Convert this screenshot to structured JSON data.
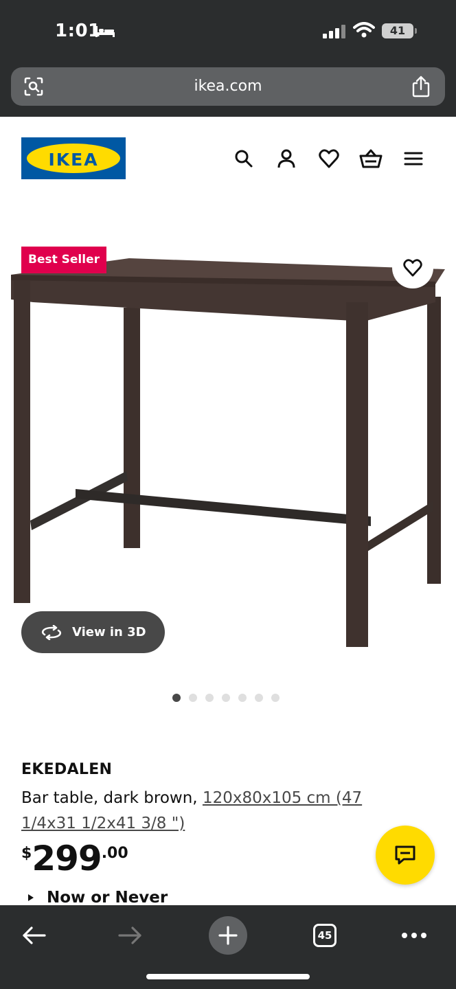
{
  "status": {
    "time": "1:01",
    "battery": "41",
    "icons": [
      "bed-icon",
      "signal-icon",
      "wifi-icon",
      "battery-icon"
    ]
  },
  "browser": {
    "url": "ikea.com",
    "left_icon": "lens-icon",
    "right_icon": "share-icon"
  },
  "header": {
    "logo_text": "IKEA",
    "icons": [
      "search-icon",
      "account-icon",
      "heart-icon",
      "cart-icon",
      "menu-icon"
    ]
  },
  "product": {
    "badge": "Best Seller",
    "view3d_label": "View in 3D",
    "name": "EKEDALEN",
    "description": "Bar table, dark brown, ",
    "dimensions": "120x80x105 cm (47 1/4x31 1/2x41 3/8 \")",
    "price_currency": "$",
    "price_int": "299",
    "price_dec": ".00",
    "promo": "Now or Never",
    "carousel": {
      "total": 7,
      "active": 1
    }
  },
  "toolbar": {
    "tab_count": "45",
    "icons": [
      "back-arrow-icon",
      "forward-arrow-icon",
      "new-tab-plus-icon",
      "tabs-icon",
      "more-icon"
    ]
  },
  "colors": {
    "ikea_blue": "#0058a3",
    "ikea_yellow": "#ffdb00",
    "badge_red": "#e0004d",
    "browser_chrome": "#2b2d2e"
  }
}
